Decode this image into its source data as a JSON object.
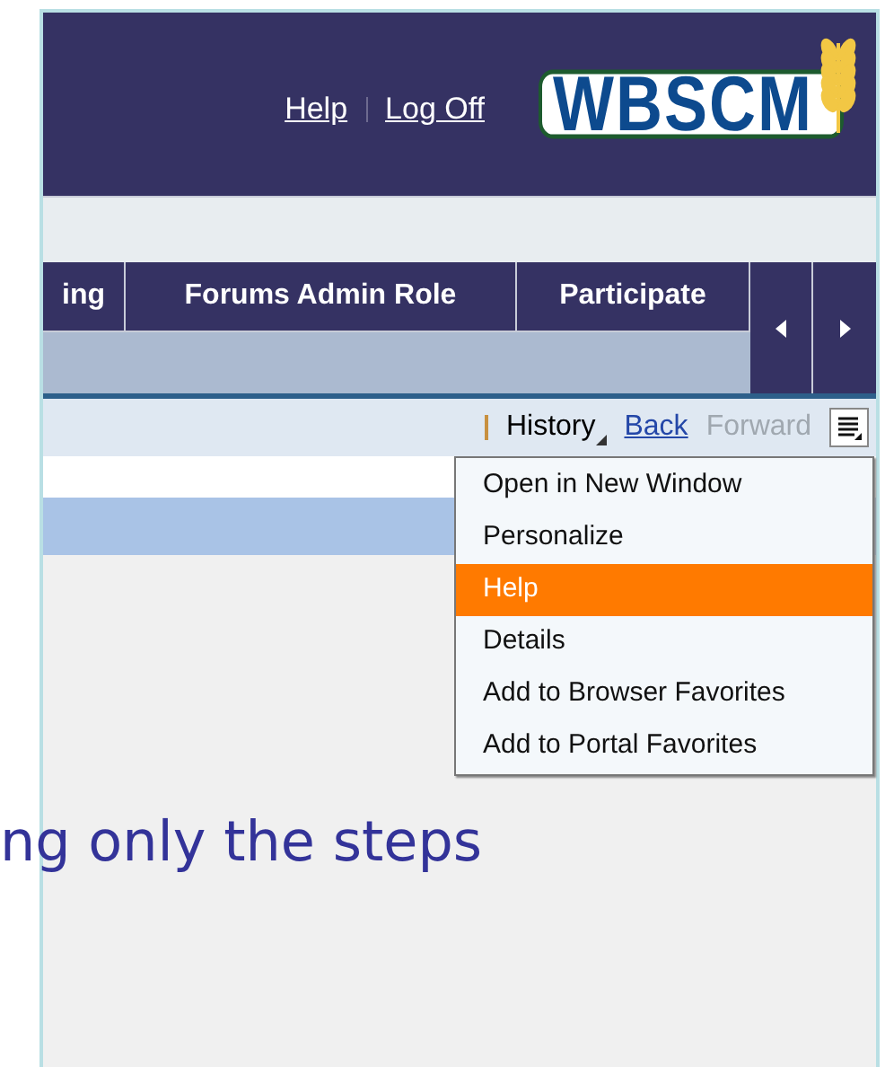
{
  "header": {
    "links": [
      {
        "label": "Help"
      },
      {
        "label": "Log Off"
      }
    ],
    "logo": "WBSCM"
  },
  "tabs": [
    {
      "label": "ing",
      "selected": false
    },
    {
      "label": "Forums Admin Role",
      "selected": false
    },
    {
      "label": "Participate",
      "selected": false
    }
  ],
  "toolbar": {
    "history": "History",
    "back": {
      "label": "Back",
      "disabled": false
    },
    "forward": {
      "label": "Forward",
      "disabled": true
    }
  },
  "menu": {
    "items": [
      {
        "label": "Open in New Window",
        "selected": false
      },
      {
        "label": "Personalize",
        "selected": false
      },
      {
        "label": "Help",
        "selected": true
      },
      {
        "label": "Details",
        "selected": false
      },
      {
        "label": "Add to Browser Favorites",
        "selected": false
      },
      {
        "label": "Add to Portal Favorites",
        "selected": false
      }
    ]
  },
  "caption": "ng only the steps"
}
